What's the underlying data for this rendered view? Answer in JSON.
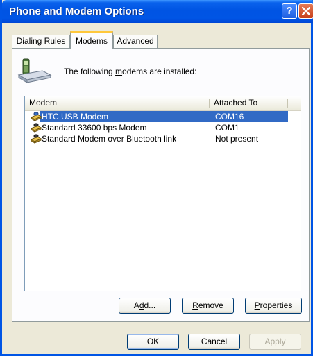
{
  "window": {
    "title": "Phone and Modem Options",
    "help_glyph": "?"
  },
  "tabs": [
    {
      "label": "Dialing Rules",
      "active": false
    },
    {
      "label": "Modems",
      "active": true
    },
    {
      "label": "Advanced",
      "active": false
    }
  ],
  "info": {
    "text_before": "The following ",
    "text_underlined": "m",
    "text_after": "odems are  installed:"
  },
  "list": {
    "columns": [
      "Modem",
      "Attached To"
    ],
    "rows": [
      {
        "name": "HTC USB Modem",
        "port": "COM16",
        "selected": true,
        "icon": "modem-icon"
      },
      {
        "name": "Standard 33600 bps Modem",
        "port": "COM1",
        "selected": false,
        "icon": "modem-icon"
      },
      {
        "name": "Standard Modem over Bluetooth link",
        "port": "Not present",
        "selected": false,
        "icon": "modem-icon"
      }
    ]
  },
  "actions": {
    "add": {
      "pre": "A",
      "u": "d",
      "post": "d..."
    },
    "remove": {
      "pre": "",
      "u": "R",
      "post": "emove"
    },
    "properties": {
      "pre": "",
      "u": "P",
      "post": "roperties"
    }
  },
  "dialog_buttons": {
    "ok": "OK",
    "cancel": "Cancel",
    "apply": "Apply"
  },
  "colors": {
    "selection": "#316ac5",
    "titlebar": "#0055e5",
    "active_tab_accent": "#ffc83c"
  }
}
